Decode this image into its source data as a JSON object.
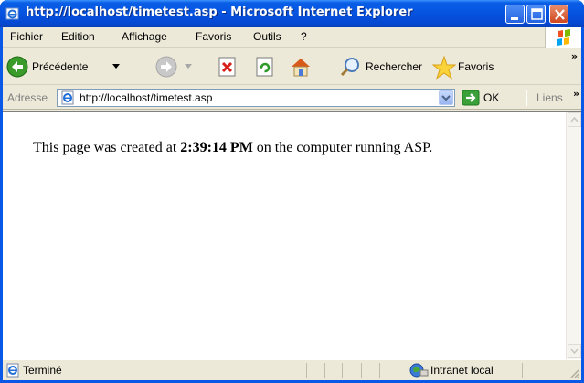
{
  "window": {
    "title": "http://localhost/timetest.asp - Microsoft Internet Explorer"
  },
  "menu": {
    "items": [
      "Fichier",
      "Edition",
      "Affichage",
      "Favoris",
      "Outils",
      "?"
    ]
  },
  "toolbar": {
    "back_label": "Précédente",
    "search_label": "Rechercher",
    "favorites_label": "Favoris",
    "more": "»"
  },
  "address": {
    "label": "Adresse",
    "url": "http://localhost/timetest.asp",
    "go_label": "OK",
    "links_label": "Liens",
    "links_more": "»"
  },
  "page": {
    "text_before": "This page was created at ",
    "time": "2:39:14 PM",
    "text_after": " on the computer running ASP."
  },
  "status": {
    "text": "Terminé",
    "zone": "Intranet local"
  },
  "colors": {
    "titlebar": "#0553e0",
    "chrome": "#ece9d8"
  }
}
